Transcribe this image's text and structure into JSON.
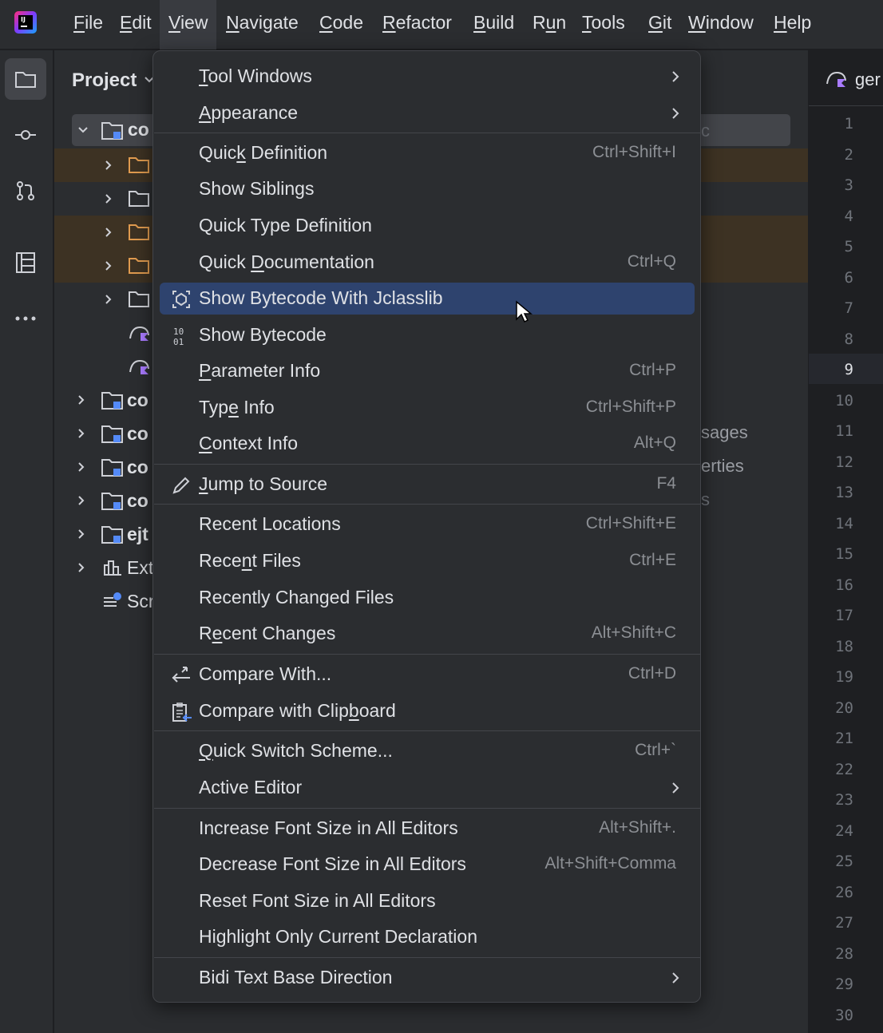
{
  "app": {
    "logo_text": "IJ"
  },
  "menubar": {
    "items": [
      {
        "label": "File",
        "u": "F"
      },
      {
        "label": "Edit",
        "u": "E"
      },
      {
        "label": "View",
        "u": "V"
      },
      {
        "label": "Navigate",
        "u": "N"
      },
      {
        "label": "Code",
        "u": "C"
      },
      {
        "label": "Refactor",
        "u": "R"
      },
      {
        "label": "Build",
        "u": "B"
      },
      {
        "label": "Run",
        "u": "u"
      },
      {
        "label": "Tools",
        "u": "T"
      },
      {
        "label": "Git",
        "u": "G"
      },
      {
        "label": "Window",
        "u": "W"
      },
      {
        "label": "Help",
        "u": "H"
      }
    ],
    "active": "View"
  },
  "toolstrip": [
    "folder-icon",
    "commit-icon",
    "pull-requests-icon",
    "structure-icon",
    "more-icon"
  ],
  "project_panel": {
    "title": "Project",
    "root_label": "co",
    "modules": [
      "co",
      "co",
      "co",
      "co",
      "ejt",
      "Ext",
      "Scr"
    ],
    "side_texts": [
      "c",
      "sages",
      "erties",
      "s"
    ]
  },
  "editor": {
    "tab_label": "ger",
    "current_line": 9,
    "line_numbers": [
      1,
      2,
      3,
      4,
      5,
      6,
      7,
      8,
      9,
      10,
      11,
      12,
      13,
      14,
      15,
      16,
      17,
      18,
      19,
      20,
      21,
      22,
      23,
      24,
      25,
      26,
      27,
      28,
      29,
      30
    ]
  },
  "view_menu": {
    "groups": [
      [
        {
          "label": "Tool Windows",
          "u": "T",
          "submenu": true
        },
        {
          "label": "Appearance",
          "u": "A",
          "submenu": true
        }
      ],
      [
        {
          "label": "Quick Definition",
          "u": "k",
          "shortcut": "Ctrl+Shift+I"
        },
        {
          "label": "Show Siblings"
        },
        {
          "label": "Quick Type Definition"
        },
        {
          "label": "Quick Documentation",
          "u": "D",
          "shortcut": "Ctrl+Q"
        },
        {
          "label": "Show Bytecode With Jclasslib",
          "icon": "jclasslib-icon",
          "selected": true
        },
        {
          "label": "Show Bytecode",
          "icon": "bytecode-icon"
        },
        {
          "label": "Parameter Info",
          "u": "P",
          "shortcut": "Ctrl+P"
        },
        {
          "label": "Type Info",
          "u": "e",
          "shortcut": "Ctrl+Shift+P"
        },
        {
          "label": "Context Info",
          "u": "C",
          "shortcut": "Alt+Q"
        }
      ],
      [
        {
          "label": "Jump to Source",
          "u": "J",
          "shortcut": "F4",
          "icon": "pencil-icon"
        }
      ],
      [
        {
          "label": "Recent Locations",
          "shortcut": "Ctrl+Shift+E"
        },
        {
          "label": "Recent Files",
          "u": "n",
          "shortcut": "Ctrl+E"
        },
        {
          "label": "Recently Changed Files"
        },
        {
          "label": "Recent Changes",
          "u": "e",
          "shortcut": "Alt+Shift+C"
        }
      ],
      [
        {
          "label": "Compare With...",
          "shortcut": "Ctrl+D",
          "icon": "compare-icon"
        },
        {
          "label": "Compare with Clipboard",
          "u": "b",
          "icon": "clipboard-compare-icon"
        }
      ],
      [
        {
          "label": "Quick Switch Scheme...",
          "u": "Q",
          "shortcut": "Ctrl+`"
        },
        {
          "label": "Active Editor",
          "submenu": true
        }
      ],
      [
        {
          "label": "Increase Font Size in All Editors",
          "shortcut": "Alt+Shift+."
        },
        {
          "label": "Decrease Font Size in All Editors",
          "shortcut": "Alt+Shift+Comma"
        },
        {
          "label": "Reset Font Size in All Editors"
        },
        {
          "label": "Highlight Only Current Declaration"
        }
      ],
      [
        {
          "label": "Bidi Text Base Direction",
          "submenu": true
        }
      ]
    ]
  },
  "colors": {
    "menubar_bg": "#2b2d30",
    "menu_bg": "#2b2d30",
    "selection": "#2e436e",
    "highlight_row": "#3d3223",
    "shortcut_text": "#8c8f94"
  }
}
